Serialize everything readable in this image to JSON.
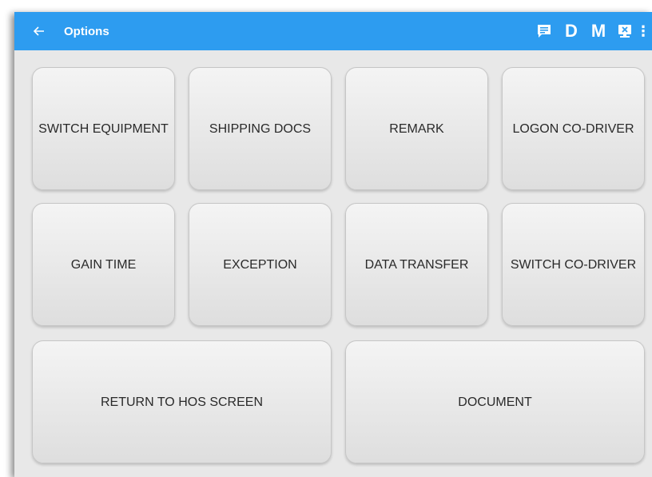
{
  "appbar": {
    "title": "Options",
    "back_icon": "arrow-left-icon",
    "actions": [
      {
        "name": "message-icon",
        "label": ""
      },
      {
        "name": "d-status",
        "label": "D"
      },
      {
        "name": "m-status",
        "label": "M"
      },
      {
        "name": "device-disconnected-icon",
        "label": ""
      },
      {
        "name": "more-vert-icon",
        "label": "⋮"
      }
    ],
    "accent_color": "#2d9cf0"
  },
  "buttons": {
    "switch_equipment": "SWITCH EQUIPMENT",
    "shipping_docs": "SHIPPING DOCS",
    "remark": "REMARK",
    "logon_co_driver": "LOGON CO-DRIVER",
    "gain_time": "GAIN TIME",
    "exception": "EXCEPTION",
    "data_transfer": "DATA TRANSFER",
    "switch_co_driver": "SWITCH CO-DRIVER",
    "return_to_hos": "RETURN TO HOS SCREEN",
    "document": "DOCUMENT"
  }
}
